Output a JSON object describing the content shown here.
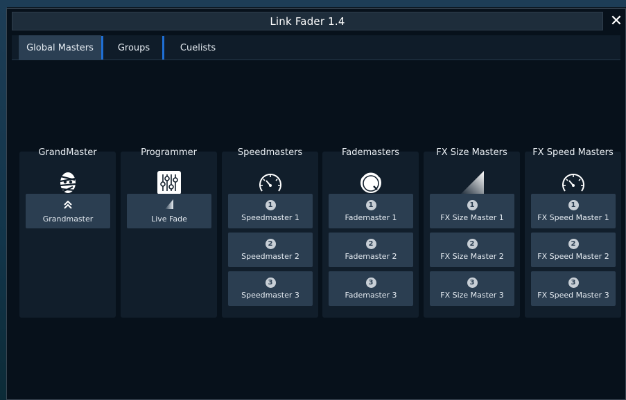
{
  "window": {
    "title": "Link Fader 1.4",
    "close_icon": "✕"
  },
  "tabs": [
    {
      "label": "Global Masters"
    },
    {
      "label": "Groups"
    },
    {
      "label": "Cuelists"
    }
  ],
  "columns": [
    {
      "title": "GrandMaster",
      "icon": "mummy-icon",
      "buttons": [
        {
          "label": "Grandmaster",
          "icon": "double-chevron-up-icon"
        }
      ]
    },
    {
      "title": "Programmer",
      "icon": "sliders-icon",
      "buttons": [
        {
          "label": "Live Fade",
          "icon": "fade-ramp-icon"
        }
      ]
    },
    {
      "title": "Speedmasters",
      "icon": "speedometer-icon",
      "buttons": [
        {
          "num": "1",
          "label": "Speedmaster 1"
        },
        {
          "num": "2",
          "label": "Speedmaster 2"
        },
        {
          "num": "3",
          "label": "Speedmaster 3"
        }
      ]
    },
    {
      "title": "Fademasters",
      "icon": "knob-icon",
      "buttons": [
        {
          "num": "1",
          "label": "Fademaster 1"
        },
        {
          "num": "2",
          "label": "Fademaster 2"
        },
        {
          "num": "3",
          "label": "Fademaster 3"
        }
      ]
    },
    {
      "title": "FX Size Masters",
      "icon": "ramp-triangle-icon",
      "buttons": [
        {
          "num": "1",
          "label": "FX Size Master 1"
        },
        {
          "num": "2",
          "label": "FX Size Master 2"
        },
        {
          "num": "3",
          "label": "FX Size Master 3"
        }
      ]
    },
    {
      "title": "FX Speed Masters",
      "icon": "speedometer-icon",
      "buttons": [
        {
          "num": "1",
          "label": "FX Speed Master 1"
        },
        {
          "num": "2",
          "label": "FX Speed Master 2"
        },
        {
          "num": "3",
          "label": "FX Speed Master 3"
        }
      ]
    }
  ],
  "colors": {
    "accent": "#1f6fd4",
    "button": "#2b3e51",
    "panel": "#111e2b",
    "window": "#07111b"
  }
}
